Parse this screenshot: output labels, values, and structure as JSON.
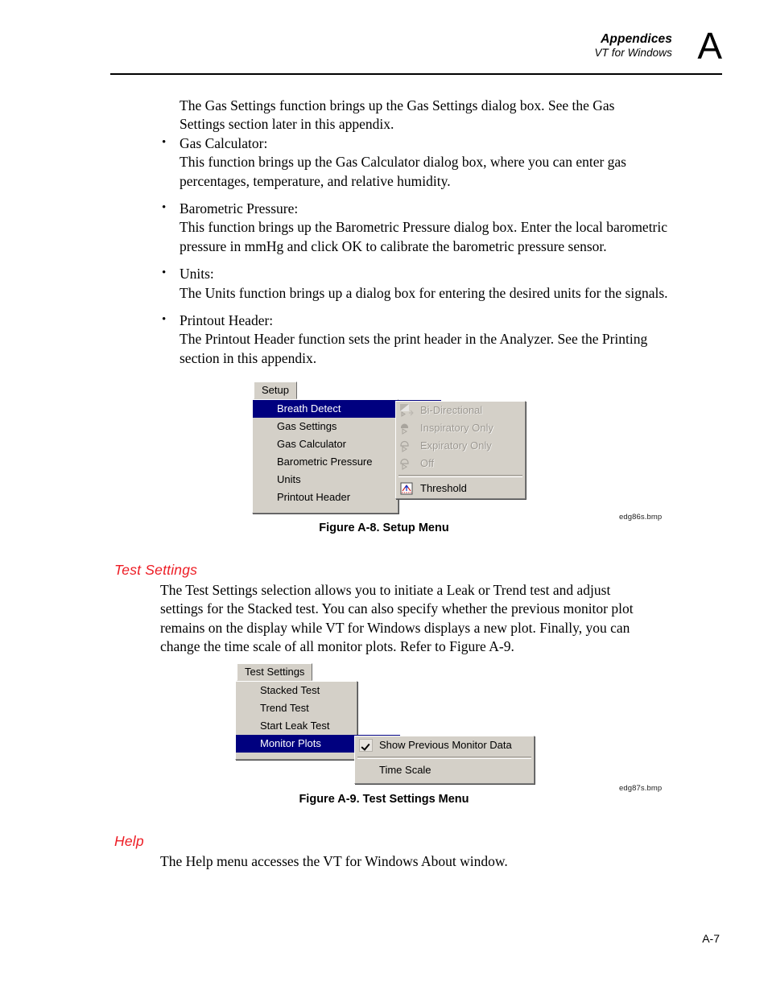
{
  "header": {
    "title": "Appendices",
    "subtitle": "VT for Windows",
    "appendix_letter": "A"
  },
  "intro_paragraph": "The Gas Settings function brings up the Gas Settings dialog box. See the Gas Settings section later in this appendix.",
  "bullets": [
    {
      "title": "Gas Calculator:",
      "body": "This function brings up the Gas Calculator dialog box, where you can enter gas percentages, temperature, and relative humidity.",
      "marker": "•"
    },
    {
      "title": "Barometric Pressure:",
      "body": "This function brings up the Barometric Pressure dialog box. Enter the local barometric pressure in mmHg and click OK to calibrate the barometric pressure sensor.",
      "marker": "•"
    },
    {
      "title": "Units:",
      "body": "The Units function brings up a dialog box for entering the desired units for the signals.",
      "marker": "•"
    },
    {
      "title": "Printout Header:",
      "body": "The Printout Header function sets the print header in the Analyzer. See the Printing section in this appendix.",
      "marker": "•"
    }
  ],
  "figure_setup": {
    "menu_tab_label": "Setup",
    "items": [
      {
        "label": "Breath Detect",
        "selected": true,
        "submenu": true
      },
      {
        "label": "Gas Settings",
        "selected": false,
        "submenu": false
      },
      {
        "label": "Gas Calculator",
        "selected": false,
        "submenu": false
      },
      {
        "label": "Barometric Pressure",
        "selected": false,
        "submenu": false
      },
      {
        "label": "Units",
        "selected": false,
        "submenu": false
      },
      {
        "label": "Printout Header",
        "selected": false,
        "submenu": false
      }
    ],
    "submenu_items": [
      {
        "label": "Bi-Directional",
        "disabled": true,
        "icon": "bi-directional-icon"
      },
      {
        "label": "Inspiratory Only",
        "disabled": true,
        "icon": "inspiratory-only-icon"
      },
      {
        "label": "Expiratory Only",
        "disabled": true,
        "icon": "expiratory-only-icon"
      },
      {
        "label": "Off",
        "disabled": true,
        "icon": "off-icon"
      },
      {
        "label": "Threshold",
        "disabled": false,
        "icon": "threshold-icon"
      }
    ],
    "caption": "Figure A-8. Setup Menu",
    "bmp_label": "edg86s.bmp"
  },
  "section_test_settings": {
    "heading": "Test Settings",
    "paragraph": "The Test Settings selection allows you to initiate a Leak or Trend test and adjust settings for the Stacked test. You can also specify whether the previous monitor plot remains on the display while VT for Windows displays a new plot. Finally, you can change the time scale of all monitor plots. Refer to Figure A-9."
  },
  "figure_test_settings": {
    "menu_tab_label": "Test Settings",
    "items": [
      {
        "label": "Stacked Test",
        "selected": false,
        "submenu": false
      },
      {
        "label": "Trend Test",
        "selected": false,
        "submenu": false
      },
      {
        "label": "Start Leak Test",
        "selected": false,
        "submenu": false
      },
      {
        "label": "Monitor Plots",
        "selected": true,
        "submenu": true
      }
    ],
    "submenu_items": [
      {
        "label": "Show Previous Monitor Data",
        "checked": true
      },
      {
        "label": "Time Scale",
        "checked": false
      }
    ],
    "caption": "Figure A-9. Test Settings Menu",
    "bmp_label": "edg87s.bmp"
  },
  "section_help": {
    "heading": "Help",
    "paragraph": "The Help menu accesses the VT for Windows About window."
  },
  "footer": {
    "page_number": "A-7"
  },
  "colors": {
    "heading_red": "#ed1c24",
    "menu_face": "#d4d0c8",
    "menu_highlight": "#00007f",
    "menu_disabled_text": "#9a968f"
  }
}
